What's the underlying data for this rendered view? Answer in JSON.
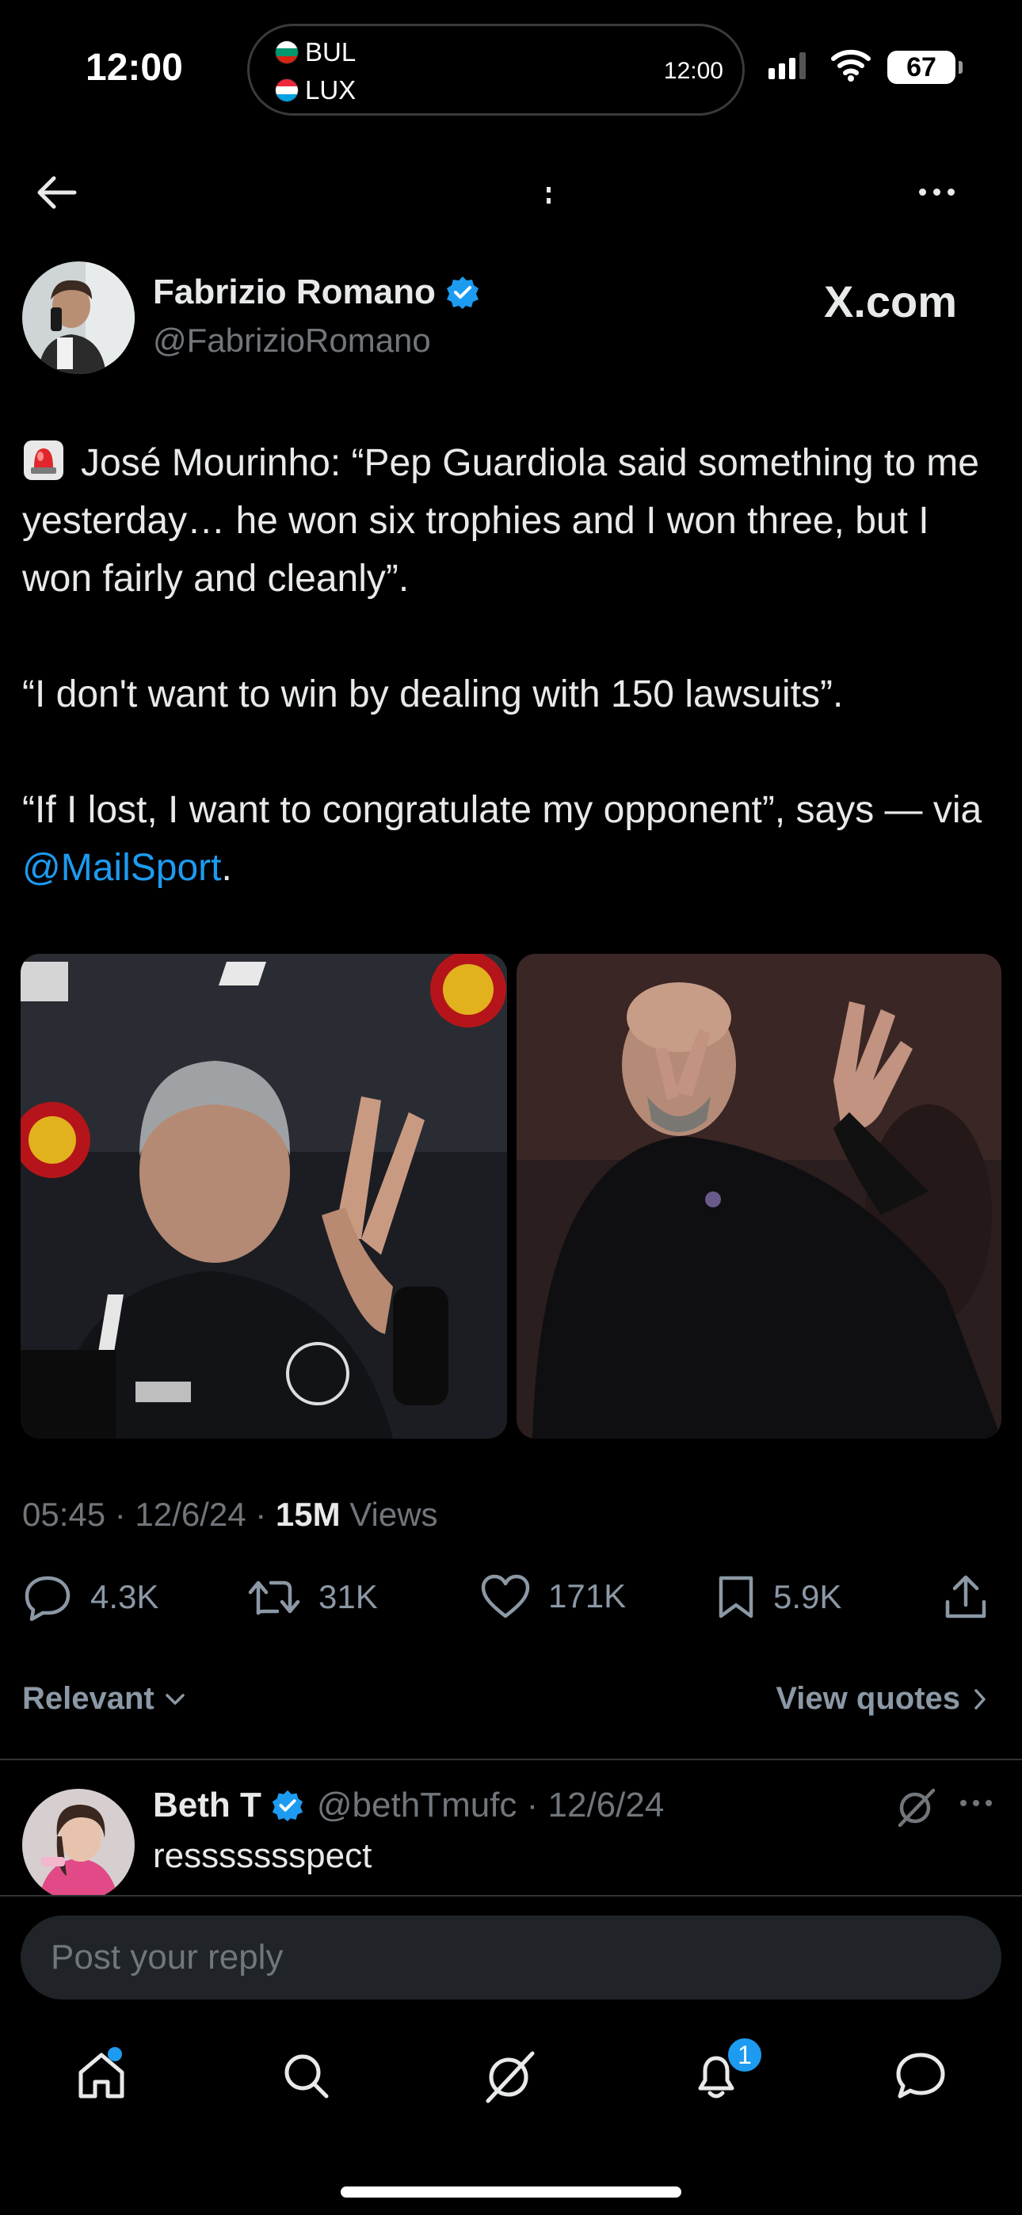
{
  "status_bar": {
    "time": "12:00",
    "live_activity": {
      "team_1": "BUL",
      "team_2": "LUX",
      "time": "12:00"
    },
    "battery": "67"
  },
  "header": {
    "back_icon": "arrow-left-icon",
    "more_icon": "more-horizontal-icon"
  },
  "tweet": {
    "author": {
      "name": "Fabrizio Romano",
      "handle": "@FabrizioRomano",
      "verified": true
    },
    "watermark": "X.com",
    "text": {
      "p1": "José Mourinho: “Pep Guardiola said something to me yesterday… he won six trophies and I won three, but I won fairly and cleanly”.",
      "p2": "“I don't want to win by dealing with 150 lawsuits”.",
      "p3_pre": "“If I lost, I want to congratulate my opponent”, says — via ",
      "p3_mention": "@MailSport",
      "p3_post": "."
    },
    "timestamp": "05:45 · 12/6/24 · ",
    "views_count": "15M",
    "views_label": " Views",
    "stats": {
      "replies": "4.3K",
      "reposts": "31K",
      "likes": "171K",
      "bookmarks": "5.9K"
    }
  },
  "sort": {
    "label": "Relevant",
    "view_quotes": "View quotes"
  },
  "reply": {
    "name": "Beth T",
    "handle": "@bethTmufc · 12/6/24",
    "text": "ressssssspect"
  },
  "composer": {
    "placeholder": "Post your reply"
  },
  "nav": {
    "items": [
      "home-icon",
      "search-icon",
      "grok-icon",
      "notifications-icon",
      "messages-icon"
    ],
    "notifications_badge": "1"
  },
  "colors": {
    "accent": "#1d9bf0",
    "background": "#000000",
    "muted": "#71767b"
  }
}
